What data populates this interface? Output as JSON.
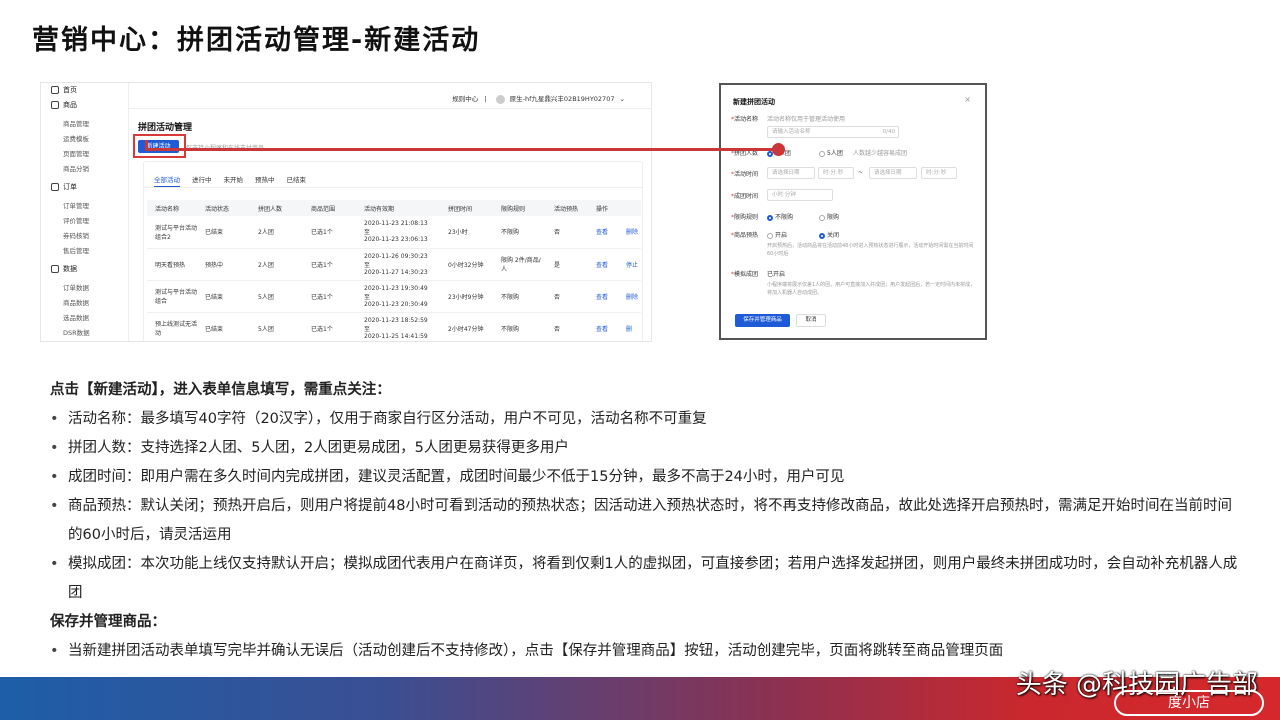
{
  "page_title": "营销中心：拼团活动管理-新建活动",
  "admin": {
    "sidebar": [
      {
        "label": "首页",
        "sub": []
      },
      {
        "label": "商品",
        "sub": [
          "商品管理",
          "运费模板",
          "页面管理",
          "商品分销"
        ]
      },
      {
        "label": "订单",
        "sub": [
          "订单管理",
          "评价管理",
          "券码核销",
          "售后管理"
        ]
      },
      {
        "label": "数据",
        "sub": [
          "订单数据",
          "商品数据",
          "选品数据",
          "DSR数据"
        ]
      }
    ],
    "topbar": {
      "rule_center": "规则中心",
      "separator": "|",
      "account": "原生-hf九星鼎兴丰02B19HY02707",
      "caret": "⌄"
    },
    "heading": "拼团活动管理",
    "new_button": "新建活动",
    "hint": "仅支持小程序和在线支付商品",
    "tabs": [
      "全部活动",
      "进行中",
      "未开始",
      "预热中",
      "已结束"
    ],
    "columns": [
      "活动名称",
      "活动状态",
      "拼团人数",
      "商品范围",
      "活动有效期",
      "拼团时间",
      "限购规则",
      "活动预热",
      "操作"
    ],
    "rows": [
      {
        "name": "测试与平台活动组合2",
        "status": "已结束",
        "size": "2人团",
        "scope": "已选1个",
        "start": "2020-11-23 21:08:13",
        "to": "至",
        "end": "2020-11-23 23:06:13",
        "duration": "23小时",
        "limit": "不限购",
        "preheat": "否",
        "a1": "查看",
        "a2": "删除"
      },
      {
        "name": "明天看预热",
        "status": "预热中",
        "size": "2人团",
        "scope": "已选1个",
        "start": "2020-11-26 09:30:23",
        "to": "至",
        "end": "2020-11-27 14:30:23",
        "duration": "0小时32分钟",
        "limit": "限购 2件/商品/人",
        "preheat": "是",
        "a1": "查看",
        "a2": "停止"
      },
      {
        "name": "测试与平台活动组合",
        "status": "已结束",
        "size": "5人团",
        "scope": "已选1个",
        "start": "2020-11-23 19:30:49",
        "to": "至",
        "end": "2020-11-23 20:30:49",
        "duration": "23小时9分钟",
        "limit": "不限购",
        "preheat": "否",
        "a1": "查看",
        "a2": "删除"
      },
      {
        "name": "预上线测试无活动",
        "status": "已结束",
        "size": "5人团",
        "scope": "已选1个",
        "start": "2020-11-23 18:52:59",
        "to": "至",
        "end": "2020-11-25 14:41:59",
        "duration": "2小时47分钟",
        "limit": "不限购",
        "preheat": "否",
        "a1": "查看",
        "a2": "删"
      }
    ]
  },
  "dialog": {
    "title": "新建拼团活动",
    "close": "×",
    "name_label": "活动名称",
    "name_hint": "活动名称仅用于管理活动使用",
    "name_placeholder": "请输入活动名称",
    "name_count": "0/40",
    "size_label": "拼团人数",
    "size_opt1": "2人团",
    "size_opt2": "5人团",
    "size_note": "人数越少越容易成团",
    "time_label": "活动时间",
    "date_placeholder": "请选择日期",
    "time_placeholder": "时:分:秒",
    "time_sep": "~",
    "form_label": "成团时间",
    "form_placeholder": "小时:分钟",
    "limit_label": "限购规则",
    "limit_opt1": "不限购",
    "limit_opt2": "限购",
    "preheat_label": "商品预热",
    "preheat_opt1": "开启",
    "preheat_opt2": "关闭",
    "preheat_note": "开启预热后，活动商品将在活动前48小时进入预热状态进行展示，活动开始时间需在当前时间60小时后",
    "sim_label": "模拟成团",
    "sim_value": "已开启",
    "sim_note": "小程序端将展示仅差1人的团，用户可直接加入并成团；用户发起团后，若一定时间内未拼成，将加入机器人自动成团。",
    "save": "保存并管理商品",
    "cancel": "取消"
  },
  "content": {
    "intro": "点击【新建活动】，进入表单信息填写，需重点关注：",
    "bullets": [
      "活动名称：最多填写40字符（20汉字），仅用于商家自行区分活动，用户不可见，活动名称不可重复",
      "拼团人数：支持选择2人团、5人团，2人团更易成团，5人团更易获得更多用户",
      "成团时间：即用户需在多久时间内完成拼团，建议灵活配置，成团时间最少不低于15分钟，最多不高于24小时，用户可见",
      "商品预热：默认关闭；预热开启后，则用户将提前48小时可看到活动的预热状态；因活动进入预热状态时，将不再支持修改商品，故此处选择开启预热时，需满足开始时间在当前时间的60小时后，请灵活运用",
      "模拟成团：本次功能上线仅支持默认开启；模拟成团代表用户在商详页，将看到仅剩1人的虚拟团，可直接参团；若用户选择发起拼团，则用户最终未拼团成功时，会自动补充机器人成团"
    ],
    "save_heading": "保存并管理商品：",
    "save_bullet": "当新建拼团活动表单填写完毕并确认无误后（活动创建后不支持修改），点击【保存并管理商品】按钮，活动创建完毕，页面将跳转至商品管理页面"
  },
  "footer": {
    "watermark": "头条 @科技园广告部",
    "badge": "度小店"
  },
  "colors": {
    "accent": "#1f5bd6",
    "highlight": "#c9373a"
  }
}
